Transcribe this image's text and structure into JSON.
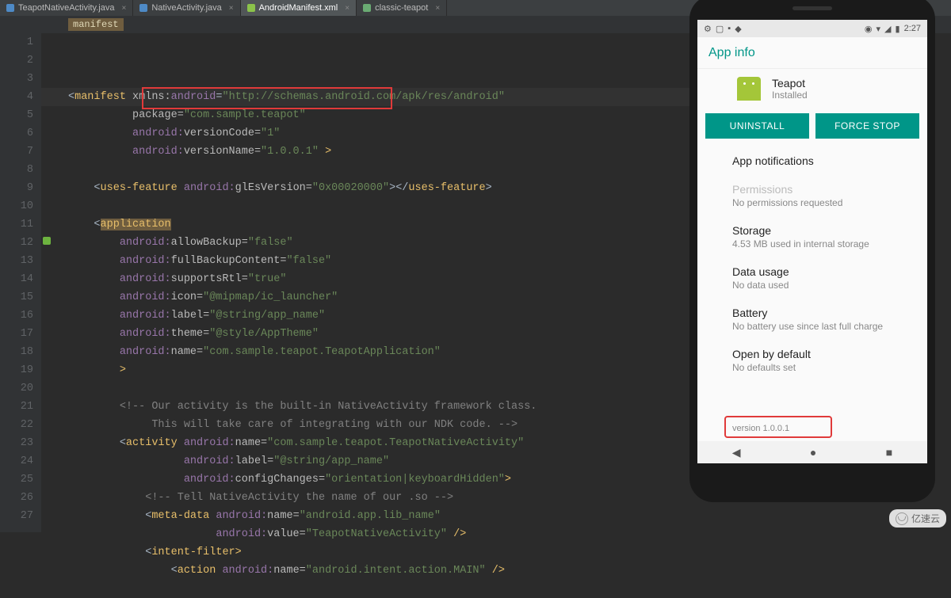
{
  "tabs": [
    {
      "label": "TeapotNativeActivity.java",
      "icon": "java",
      "active": false
    },
    {
      "label": "NativeActivity.java",
      "icon": "java",
      "active": false
    },
    {
      "label": "AndroidManifest.xml",
      "icon": "xml",
      "active": true
    },
    {
      "label": "classic-teapot",
      "icon": "txt",
      "active": false
    }
  ],
  "breadcrumb": "manifest",
  "lines": {
    "l1a": "manifest",
    "l1b": "xmlns:",
    "l1c": "android",
    "l1d": "\"http://schemas.android.com/apk/res/android\"",
    "l2a": "package=",
    "l2b": "\"com.sample.teapot\"",
    "l3a": "android:",
    "l3b": "versionCode=",
    "l3c": "\"1\"",
    "l4a": "android:",
    "l4b": "versionName=",
    "l4c": "\"1.0.0.1\"",
    "l4d": " >",
    "l6a": "uses-feature",
    "l6b": "android:",
    "l6c": "glEsVersion=",
    "l6d": "\"0x00020000\"",
    "l6e": "uses-feature",
    "l8a": "application",
    "l9a": "android:",
    "l9b": "allowBackup=",
    "l9c": "\"false\"",
    "l10a": "android:",
    "l10b": "fullBackupContent=",
    "l10c": "\"false\"",
    "l11a": "android:",
    "l11b": "supportsRtl=",
    "l11c": "\"true\"",
    "l12a": "android:",
    "l12b": "icon=",
    "l12c": "\"@mipmap/ic_launcher\"",
    "l13a": "android:",
    "l13b": "label=",
    "l13c": "\"@string/app_name\"",
    "l14a": "android:",
    "l14b": "theme=",
    "l14c": "\"@style/AppTheme\"",
    "l15a": "android:",
    "l15b": "name=",
    "l15c": "\"com.sample.teapot.TeapotApplication\"",
    "l16a": ">",
    "l18a": "<!-- Our activity is the built-in NativeActivity framework class.",
    "l19a": "     This will take care of integrating with our NDK code. -->",
    "l20a": "activity",
    "l20b": "android:",
    "l20c": "name=",
    "l20d": "\"com.sample.teapot.TeapotNativeActivity\"",
    "l21a": "android:",
    "l21b": "label=",
    "l21c": "\"@string/app_name\"",
    "l22a": "android:",
    "l22b": "configChanges=",
    "l22c": "\"orientation|keyboardHidden\"",
    "l22d": ">",
    "l23a": "<!-- Tell NativeActivity the name of our .so -->",
    "l24a": "meta-data",
    "l24b": "android:",
    "l24c": "name=",
    "l24d": "\"android.app.lib_name\"",
    "l25a": "android:",
    "l25b": "value=",
    "l25c": "\"TeapotNativeActivity\"",
    "l25d": " />",
    "l26a": "intent-filter",
    "l26b": ">",
    "l27a": "action",
    "l27b": "android:",
    "l27c": "name=",
    "l27d": "\"android.intent.action.MAIN\"",
    "l27e": " />"
  },
  "line_numbers": [
    "1",
    "2",
    "3",
    "4",
    "5",
    "6",
    "7",
    "8",
    "9",
    "10",
    "11",
    "12",
    "13",
    "14",
    "15",
    "16",
    "17",
    "18",
    "19",
    "20",
    "21",
    "22",
    "23",
    "24",
    "25",
    "26",
    "27"
  ],
  "phone": {
    "time": "2:27",
    "appbar": "App info",
    "app_name": "Teapot",
    "app_status": "Installed",
    "btn_uninstall": "UNINSTALL",
    "btn_forcestop": "FORCE STOP",
    "rows": [
      {
        "t": "App notifications",
        "s": ""
      },
      {
        "t": "Permissions",
        "s": "No permissions requested",
        "disabled": true
      },
      {
        "t": "Storage",
        "s": "4.53 MB used in internal storage"
      },
      {
        "t": "Data usage",
        "s": "No data used"
      },
      {
        "t": "Battery",
        "s": "No battery use since last full charge"
      },
      {
        "t": "Open by default",
        "s": "No defaults set"
      }
    ],
    "version": "version 1.0.0.1"
  },
  "watermark": "亿速云"
}
